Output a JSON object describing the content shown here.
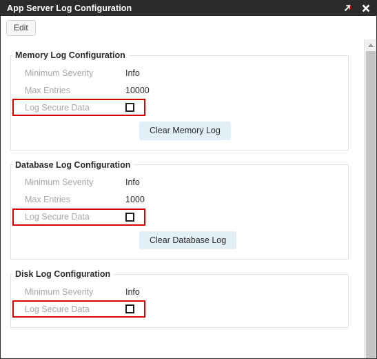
{
  "window": {
    "title": "App Server Log Configuration",
    "titlebar_actions": [
      {
        "name": "expand-icon",
        "label": "Expand"
      },
      {
        "name": "close-icon",
        "label": "Close"
      }
    ],
    "accent_color": "#d40000",
    "titlebar_bg": "#2b2b2b",
    "button_bg": "#e3eff7"
  },
  "toolbar": {
    "edit_label": "Edit"
  },
  "scrollbar": {
    "up_arrow": "▲"
  },
  "sections": [
    {
      "legend": "Memory Log Configuration",
      "rows": [
        {
          "label": "Minimum Severity",
          "value": "Info",
          "type": "text"
        },
        {
          "label": "Max Entries",
          "value": "10000",
          "type": "text"
        },
        {
          "label": "Log Secure Data",
          "value": "",
          "type": "checkbox",
          "checked": false,
          "highlighted": true
        }
      ],
      "button": "Clear Memory Log"
    },
    {
      "legend": "Database Log Configuration",
      "rows": [
        {
          "label": "Minimum Severity",
          "value": "Info",
          "type": "text"
        },
        {
          "label": "Max Entries",
          "value": "1000",
          "type": "text"
        },
        {
          "label": "Log Secure Data",
          "value": "",
          "type": "checkbox",
          "checked": false,
          "highlighted": true
        }
      ],
      "button": "Clear Database Log"
    },
    {
      "legend": "Disk Log Configuration",
      "rows": [
        {
          "label": "Minimum Severity",
          "value": "Info",
          "type": "text"
        },
        {
          "label": "Log Secure Data",
          "value": "",
          "type": "checkbox",
          "checked": false,
          "highlighted": true
        }
      ],
      "button": null
    }
  ]
}
